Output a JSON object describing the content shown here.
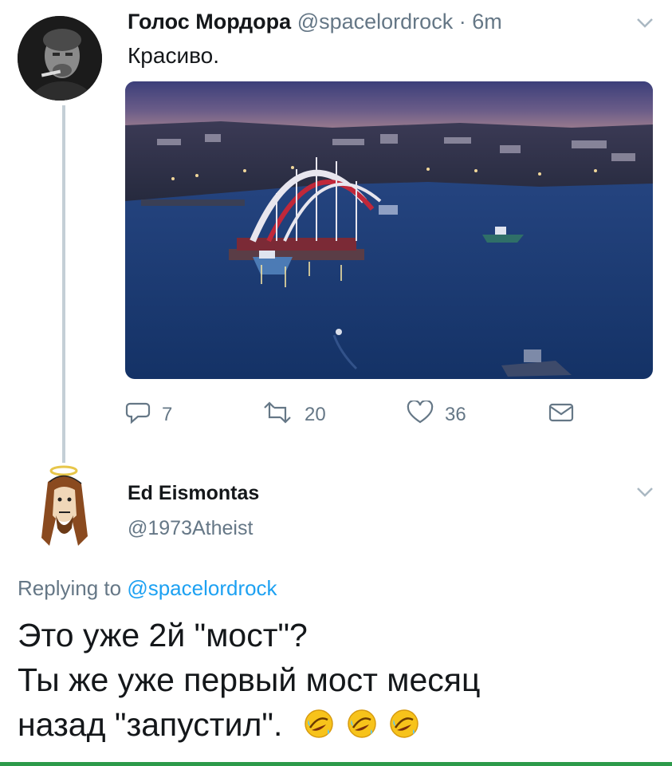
{
  "tweet1": {
    "display_name": "Голос Мордора",
    "handle": "@spacelordrock",
    "time": "· 6m",
    "text": "Красиво.",
    "avatar_icon": "user-avatar-photo",
    "image_icon": "bridge-arch-photo",
    "actions": {
      "reply_count": "7",
      "retweet_count": "20",
      "like_count": "36"
    }
  },
  "tweet2": {
    "display_name": "Ed Eismontas",
    "handle": "@1973Atheist",
    "replying_prefix": "Replying to",
    "replying_handle": "@spacelordrock",
    "text_line1": "Это уже 2й \"мост\"?",
    "text_line2": "Ты же уже первый мост месяц",
    "text_line3": "назад \"запустил\". ",
    "emoji": "rolling-on-floor-laughing-emoji",
    "emoji_count": 3
  },
  "colors": {
    "link": "#1da1f2",
    "muted": "#657786",
    "thread_line": "#c4cfd6"
  }
}
